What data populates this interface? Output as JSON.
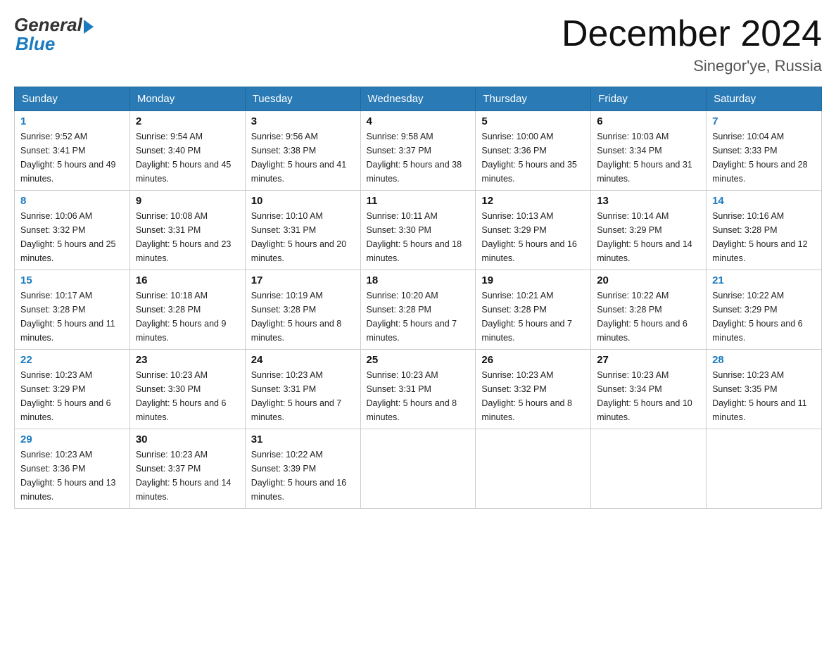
{
  "header": {
    "logo_general": "General",
    "logo_blue": "Blue",
    "month_title": "December 2024",
    "location": "Sinegor'ye, Russia"
  },
  "weekdays": [
    "Sunday",
    "Monday",
    "Tuesday",
    "Wednesday",
    "Thursday",
    "Friday",
    "Saturday"
  ],
  "weeks": [
    [
      {
        "day": "1",
        "sunrise": "9:52 AM",
        "sunset": "3:41 PM",
        "daylight": "5 hours and 49 minutes."
      },
      {
        "day": "2",
        "sunrise": "9:54 AM",
        "sunset": "3:40 PM",
        "daylight": "5 hours and 45 minutes."
      },
      {
        "day": "3",
        "sunrise": "9:56 AM",
        "sunset": "3:38 PM",
        "daylight": "5 hours and 41 minutes."
      },
      {
        "day": "4",
        "sunrise": "9:58 AM",
        "sunset": "3:37 PM",
        "daylight": "5 hours and 38 minutes."
      },
      {
        "day": "5",
        "sunrise": "10:00 AM",
        "sunset": "3:36 PM",
        "daylight": "5 hours and 35 minutes."
      },
      {
        "day": "6",
        "sunrise": "10:03 AM",
        "sunset": "3:34 PM",
        "daylight": "5 hours and 31 minutes."
      },
      {
        "day": "7",
        "sunrise": "10:04 AM",
        "sunset": "3:33 PM",
        "daylight": "5 hours and 28 minutes."
      }
    ],
    [
      {
        "day": "8",
        "sunrise": "10:06 AM",
        "sunset": "3:32 PM",
        "daylight": "5 hours and 25 minutes."
      },
      {
        "day": "9",
        "sunrise": "10:08 AM",
        "sunset": "3:31 PM",
        "daylight": "5 hours and 23 minutes."
      },
      {
        "day": "10",
        "sunrise": "10:10 AM",
        "sunset": "3:31 PM",
        "daylight": "5 hours and 20 minutes."
      },
      {
        "day": "11",
        "sunrise": "10:11 AM",
        "sunset": "3:30 PM",
        "daylight": "5 hours and 18 minutes."
      },
      {
        "day": "12",
        "sunrise": "10:13 AM",
        "sunset": "3:29 PM",
        "daylight": "5 hours and 16 minutes."
      },
      {
        "day": "13",
        "sunrise": "10:14 AM",
        "sunset": "3:29 PM",
        "daylight": "5 hours and 14 minutes."
      },
      {
        "day": "14",
        "sunrise": "10:16 AM",
        "sunset": "3:28 PM",
        "daylight": "5 hours and 12 minutes."
      }
    ],
    [
      {
        "day": "15",
        "sunrise": "10:17 AM",
        "sunset": "3:28 PM",
        "daylight": "5 hours and 11 minutes."
      },
      {
        "day": "16",
        "sunrise": "10:18 AM",
        "sunset": "3:28 PM",
        "daylight": "5 hours and 9 minutes."
      },
      {
        "day": "17",
        "sunrise": "10:19 AM",
        "sunset": "3:28 PM",
        "daylight": "5 hours and 8 minutes."
      },
      {
        "day": "18",
        "sunrise": "10:20 AM",
        "sunset": "3:28 PM",
        "daylight": "5 hours and 7 minutes."
      },
      {
        "day": "19",
        "sunrise": "10:21 AM",
        "sunset": "3:28 PM",
        "daylight": "5 hours and 7 minutes."
      },
      {
        "day": "20",
        "sunrise": "10:22 AM",
        "sunset": "3:28 PM",
        "daylight": "5 hours and 6 minutes."
      },
      {
        "day": "21",
        "sunrise": "10:22 AM",
        "sunset": "3:29 PM",
        "daylight": "5 hours and 6 minutes."
      }
    ],
    [
      {
        "day": "22",
        "sunrise": "10:23 AM",
        "sunset": "3:29 PM",
        "daylight": "5 hours and 6 minutes."
      },
      {
        "day": "23",
        "sunrise": "10:23 AM",
        "sunset": "3:30 PM",
        "daylight": "5 hours and 6 minutes."
      },
      {
        "day": "24",
        "sunrise": "10:23 AM",
        "sunset": "3:31 PM",
        "daylight": "5 hours and 7 minutes."
      },
      {
        "day": "25",
        "sunrise": "10:23 AM",
        "sunset": "3:31 PM",
        "daylight": "5 hours and 8 minutes."
      },
      {
        "day": "26",
        "sunrise": "10:23 AM",
        "sunset": "3:32 PM",
        "daylight": "5 hours and 8 minutes."
      },
      {
        "day": "27",
        "sunrise": "10:23 AM",
        "sunset": "3:34 PM",
        "daylight": "5 hours and 10 minutes."
      },
      {
        "day": "28",
        "sunrise": "10:23 AM",
        "sunset": "3:35 PM",
        "daylight": "5 hours and 11 minutes."
      }
    ],
    [
      {
        "day": "29",
        "sunrise": "10:23 AM",
        "sunset": "3:36 PM",
        "daylight": "5 hours and 13 minutes."
      },
      {
        "day": "30",
        "sunrise": "10:23 AM",
        "sunset": "3:37 PM",
        "daylight": "5 hours and 14 minutes."
      },
      {
        "day": "31",
        "sunrise": "10:22 AM",
        "sunset": "3:39 PM",
        "daylight": "5 hours and 16 minutes."
      },
      null,
      null,
      null,
      null
    ]
  ]
}
